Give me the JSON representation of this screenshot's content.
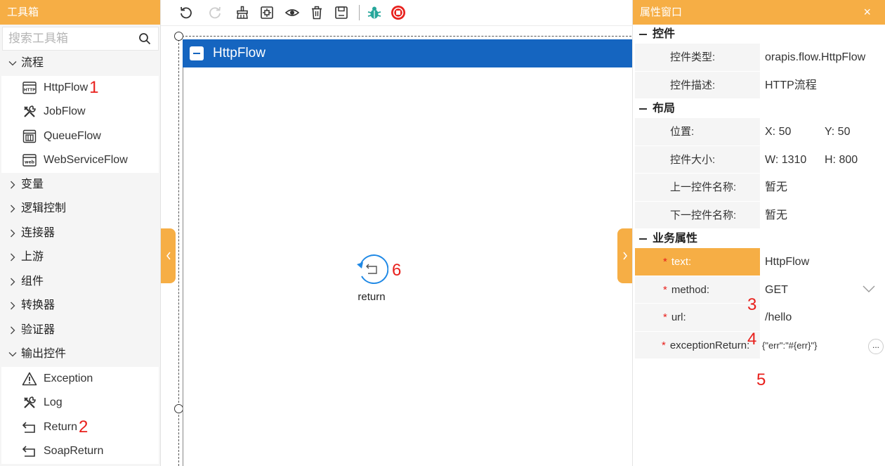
{
  "toolbox": {
    "title": "工具箱",
    "search_placeholder": "搜索工具箱",
    "categories": [
      {
        "label": "流程",
        "expanded": true,
        "items": [
          {
            "label": "HttpFlow",
            "icon": "http-icon",
            "marker": "1"
          },
          {
            "label": "JobFlow",
            "icon": "tools-icon",
            "marker": ""
          },
          {
            "label": "QueueFlow",
            "icon": "queue-icon",
            "marker": ""
          },
          {
            "label": "WebServiceFlow",
            "icon": "web-icon",
            "marker": ""
          }
        ]
      },
      {
        "label": "变量",
        "expanded": false,
        "items": []
      },
      {
        "label": "逻辑控制",
        "expanded": false,
        "items": []
      },
      {
        "label": "连接器",
        "expanded": false,
        "items": []
      },
      {
        "label": "上游",
        "expanded": false,
        "items": []
      },
      {
        "label": "组件",
        "expanded": false,
        "items": []
      },
      {
        "label": "转换器",
        "expanded": false,
        "items": []
      },
      {
        "label": "验证器",
        "expanded": false,
        "items": []
      },
      {
        "label": "输出控件",
        "expanded": true,
        "items": [
          {
            "label": "Exception",
            "icon": "warning-icon",
            "marker": ""
          },
          {
            "label": "Log",
            "icon": "tools-icon",
            "marker": ""
          },
          {
            "label": "Return",
            "icon": "return-icon",
            "marker": "2"
          },
          {
            "label": "SoapReturn",
            "icon": "return-icon",
            "marker": ""
          }
        ]
      }
    ]
  },
  "toolbar": {
    "buttons": [
      "undo-icon",
      "redo-icon",
      "clear-icon",
      "fit-icon",
      "preview-icon",
      "delete-icon",
      "save-icon",
      "debug-icon",
      "stop-icon"
    ],
    "accent_debug": "#26a69a",
    "accent_stop": "#e8201c"
  },
  "canvas": {
    "flow_title": "HttpFlow",
    "node_label": "return",
    "node_marker": "6",
    "header_color": "#1565c0"
  },
  "props": {
    "title": "属性窗口",
    "close": "×",
    "sections": {
      "control": "控件",
      "layout": "布局",
      "business": "业务属性"
    },
    "control": {
      "type_key": "控件类型:",
      "type_val": "orapis.flow.HttpFlow",
      "desc_key": "控件描述:",
      "desc_val": "HTTP流程"
    },
    "layout": {
      "pos_key": "位置:",
      "pos_x": "X: 50",
      "pos_y": "Y: 50",
      "size_key": "控件大小:",
      "size_w": "W: 1310",
      "size_h": "H: 800",
      "prev_key": "上一控件名称:",
      "prev_val": "暂无",
      "next_key": "下一控件名称:",
      "next_val": "暂无"
    },
    "business": {
      "required_mark": "*",
      "text_key": "text:",
      "text_val": "HttpFlow",
      "method_key": "method:",
      "method_val": "GET",
      "method_marker": "3",
      "url_key": "url:",
      "url_val": "/hello",
      "url_marker": "4",
      "exc_key": "exceptionReturn:",
      "exc_val": "{\"err\":\"#{err}\"}",
      "exc_marker": "5",
      "ellipsis": "..."
    }
  },
  "colors": {
    "accent": "#f6ae45",
    "flow_blue": "#1565c0",
    "marker_red": "#e8201c"
  }
}
